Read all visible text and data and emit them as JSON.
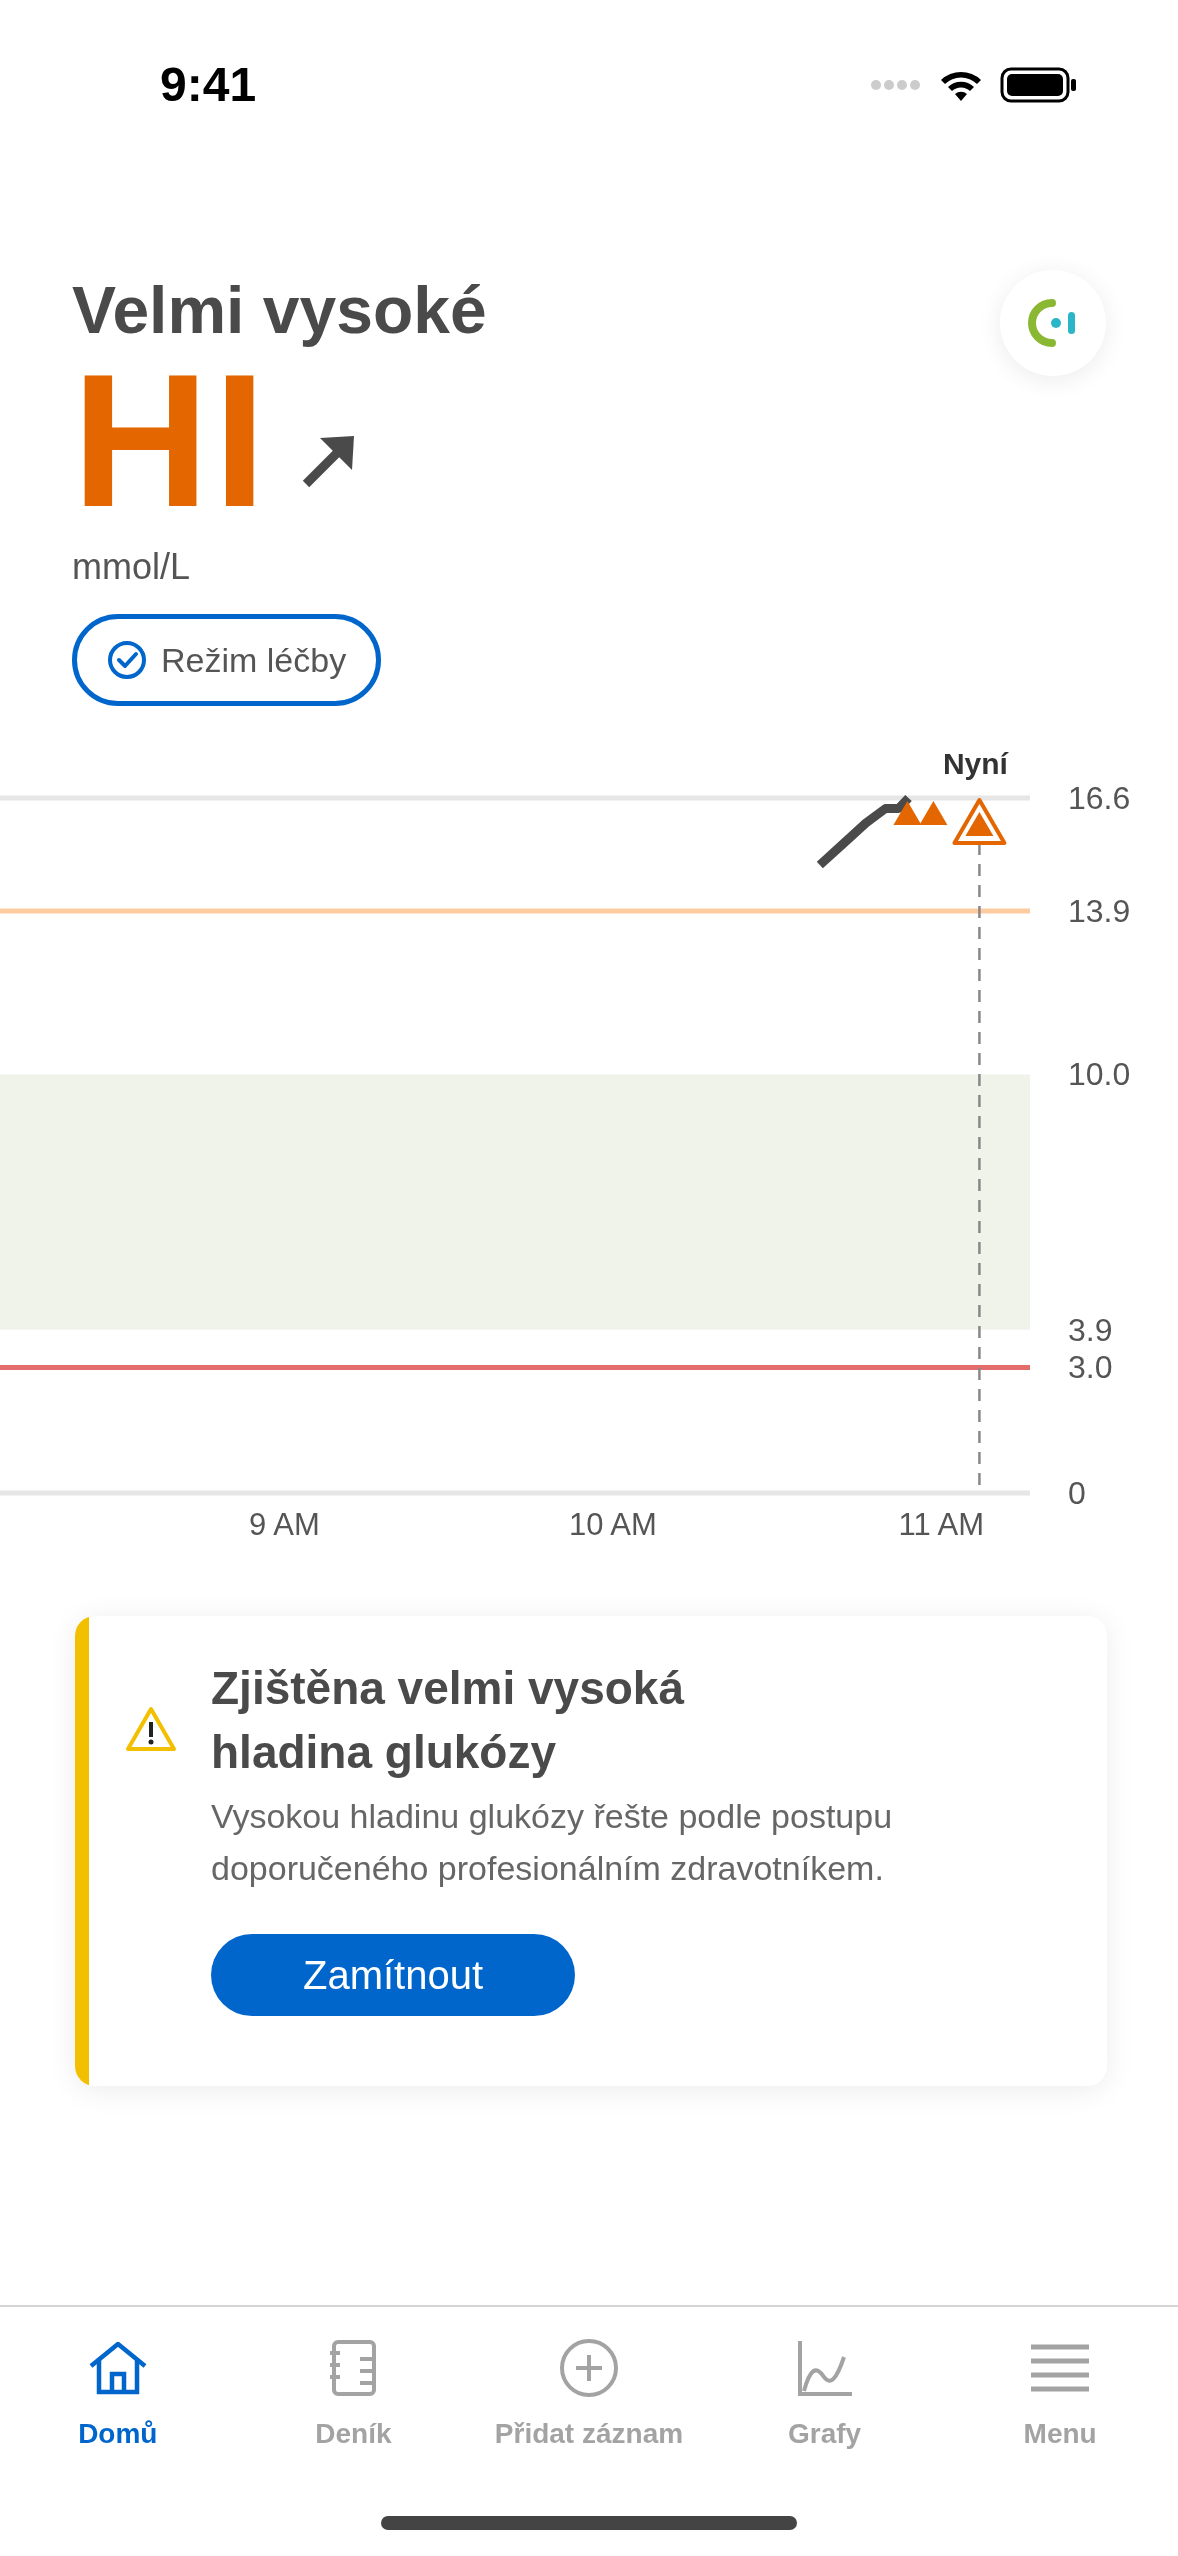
{
  "status_bar": {
    "time": "9:41"
  },
  "header": {
    "title": "Velmi vysoké",
    "reading": "HI",
    "trend": {
      "kind": "up"
    },
    "unit": "mmol/L",
    "mode_button": {
      "label": "Režim léčby",
      "checked": true
    }
  },
  "chart": {
    "hi_markers": [
      {
        "kind": "small"
      },
      {
        "kind": "small"
      },
      {
        "kind": "current"
      }
    ],
    "chart_data": {
      "type": "line",
      "x": [
        10.63,
        10.7,
        10.77,
        10.83,
        10.87,
        10.9
      ],
      "series": [
        {
          "color": "#4a4a4a",
          "values": [
            15.0,
            15.5,
            16.0,
            16.35,
            16.35,
            16.6
          ]
        }
      ],
      "xlim": [
        8.134,
        11.27
      ],
      "ylim": [
        0,
        16.6
      ],
      "xticks": [
        {
          "value": 9,
          "label": "9 AM"
        },
        {
          "value": 10,
          "label": "10 AM"
        },
        {
          "value": 11,
          "label": "11 AM"
        }
      ],
      "yticks": [
        {
          "value": 0,
          "label": "0"
        },
        {
          "value": 3,
          "label": "3.0"
        },
        {
          "value": 3.9,
          "label": "3.9"
        },
        {
          "value": 10,
          "label": "10.0"
        },
        {
          "value": 13.9,
          "label": "13.9"
        },
        {
          "value": 16.6,
          "label": "16.6"
        }
      ],
      "bands": [
        {
          "axis": "y",
          "from": 3.9,
          "to": 10,
          "color": "#f0f3e9"
        }
      ],
      "ref_lines": [
        {
          "axis": "y",
          "value": 13.9,
          "color": "#fdcba0"
        },
        {
          "axis": "y",
          "value": 3,
          "color": "#e36d6d"
        },
        {
          "axis": "x",
          "value": 11.116,
          "label": "Nyní",
          "color": "#888888"
        }
      ]
    }
  },
  "alert": {
    "title": "Zjištěna velmi vysoká hladina glukózy",
    "message": "Vysokou hladinu glukózy řešte podle postupu doporučeného profesionálním zdravotníkem.",
    "button": "Zamítnout"
  },
  "tabs": [
    {
      "label": "Domů",
      "kind": "home",
      "selected": true
    },
    {
      "label": "Deník",
      "kind": "diary",
      "selected": false
    },
    {
      "label": "Přidat záznam",
      "kind": "add",
      "selected": false
    },
    {
      "label": "Grafy",
      "kind": "graph",
      "selected": false
    },
    {
      "label": "Menu",
      "kind": "menu",
      "selected": false
    }
  ]
}
